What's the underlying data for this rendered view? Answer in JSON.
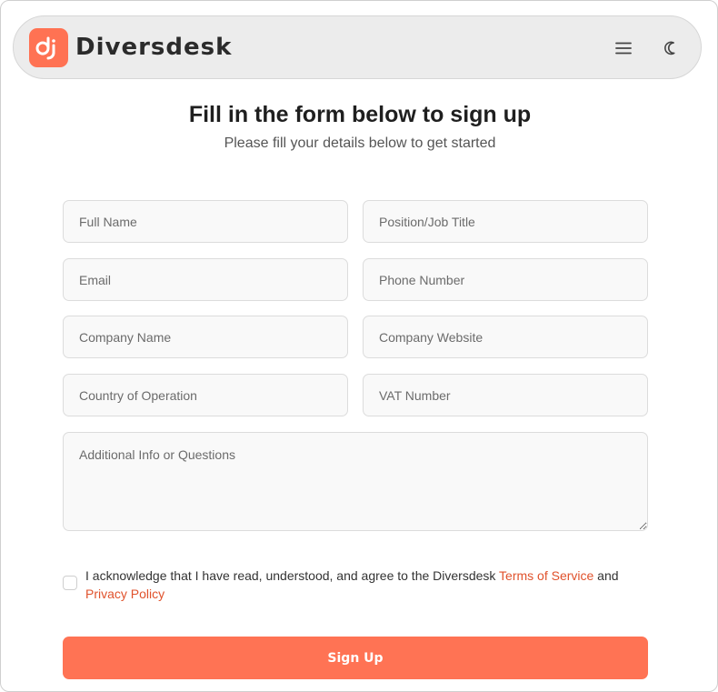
{
  "header": {
    "brand_name": "Diversdesk",
    "menu_icon": "hamburger-menu-icon",
    "theme_icon": "moon-icon"
  },
  "colors": {
    "accent": "#ff7354",
    "link": "#e0522c",
    "navbar_bg": "#ececec"
  },
  "form": {
    "title": "Fill in the form below to sign up",
    "subtitle": "Please fill your details below to get started",
    "fields": {
      "full_name": {
        "placeholder": "Full Name",
        "value": ""
      },
      "position": {
        "placeholder": "Position/Job Title",
        "value": ""
      },
      "email": {
        "placeholder": "Email",
        "value": ""
      },
      "phone": {
        "placeholder": "Phone Number",
        "value": ""
      },
      "company_name": {
        "placeholder": "Company Name",
        "value": ""
      },
      "company_website": {
        "placeholder": "Company Website",
        "value": ""
      },
      "country": {
        "placeholder": "Country of Operation",
        "value": ""
      },
      "vat": {
        "placeholder": "VAT Number",
        "value": ""
      },
      "additional_info": {
        "placeholder": "Additional Info or Questions",
        "value": ""
      }
    },
    "terms": {
      "checked": false,
      "text_before": "I acknowledge that I have read, understood, and agree to the Diversdesk ",
      "terms_link": "Terms of Service",
      "text_middle": " and ",
      "privacy_link": "Privacy Policy"
    },
    "submit_label": "Sign Up"
  }
}
